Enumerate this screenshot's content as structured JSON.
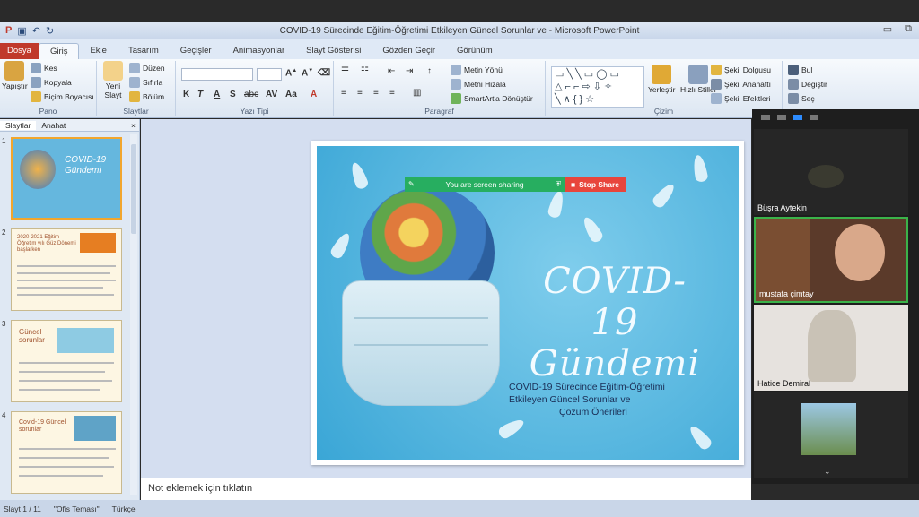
{
  "window": {
    "title": "COVID-19 Sürecinde Eğitim-Öğretimi Etkileyen Güncel Sorunlar ve  -  Microsoft PowerPoint"
  },
  "ribbon_tabs": [
    "Dosya",
    "Giriş",
    "Ekle",
    "Tasarım",
    "Geçişler",
    "Animasyonlar",
    "Slayt Gösterisi",
    "Gözden Geçir",
    "Görünüm"
  ],
  "ribbon": {
    "pano": {
      "label": "Pano",
      "paste": "Yapıştır",
      "cut": "Kes",
      "copy": "Kopyala",
      "format_painter": "Biçim Boyacısı"
    },
    "slaytlar": {
      "label": "Slaytlar",
      "new_slide": "Yeni Slayt",
      "layout": "Düzen",
      "reset": "Sıfırla",
      "section": "Bölüm"
    },
    "yazi_tipi": {
      "label": "Yazı Tipi",
      "bold": "K",
      "italic": "T",
      "underline": "A",
      "shadow": "S",
      "strike": "abc",
      "spacing": "AV",
      "case": "Aa",
      "color": "A"
    },
    "paragraf": {
      "label": "Paragraf",
      "text_direction": "Metin Yönü",
      "align_text": "Metni Hizala",
      "smartart": "SmartArt'a Dönüştür"
    },
    "cizim": {
      "label": "Çizim",
      "arrange": "Yerleştir",
      "quick_styles": "Hızlı Stiller",
      "fill": "Şekil Dolgusu",
      "outline": "Şekil Anahattı",
      "effects": "Şekil Efektleri"
    },
    "duzenleme": {
      "find": "Bul",
      "replace": "Değiştir",
      "select": "Seç"
    }
  },
  "left_pane": {
    "tabs": [
      "Slaytlar",
      "Anahat"
    ],
    "close": "×",
    "thumbnails": [
      {
        "num": "1",
        "title": "COVID-19 Gündemi"
      },
      {
        "num": "2",
        "title": "2020-2021 Eğitim Öğretim yılı Güz Dönemi başlarken"
      },
      {
        "num": "3",
        "title": "Güncel sorunlar"
      },
      {
        "num": "4",
        "title": "Covid-19 Güncel sorunlar"
      }
    ]
  },
  "slide": {
    "title_line1": "COVID-19",
    "title_line2": "Gündemi",
    "subtitle_line1": "COVID-19 Sürecinde Eğitim-Öğretimi",
    "subtitle_line2": "Etkileyen Güncel Sorunlar ve",
    "subtitle_line3": "Çözüm Önerileri"
  },
  "share_bar": {
    "status": "You are screen sharing",
    "stop": "Stop Share"
  },
  "notes": {
    "placeholder": "Not eklemek için tıklatın"
  },
  "status_bar": {
    "slide": "Slayt 1 / 11",
    "theme": "\"Ofis Teması\"",
    "language": "Türkçe"
  },
  "participants": [
    {
      "name": "Büşra Aytekin"
    },
    {
      "name": "mustafa çimtay"
    },
    {
      "name": "Hatice Demiral"
    },
    {
      "name": ""
    }
  ],
  "colors": {
    "accent": "#2d8cff",
    "share_green": "#27ae60",
    "stop_red": "#e8453c",
    "file_tab": "#c0392b"
  }
}
